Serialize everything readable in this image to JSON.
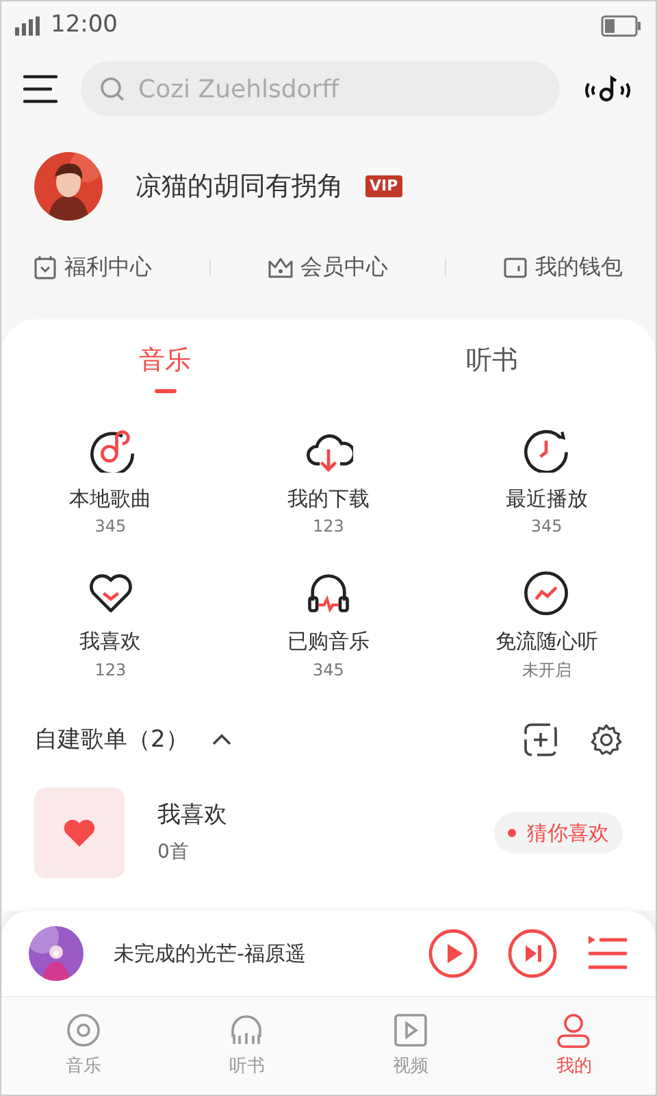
{
  "status_bar": {
    "time": "12:00"
  },
  "search": {
    "placeholder": "Cozi Zuehlsdorff"
  },
  "profile": {
    "name": "凉猫的胡同有拐角",
    "badge": "VIP"
  },
  "quick_links": [
    {
      "label": "福利中心"
    },
    {
      "label": "会员中心"
    },
    {
      "label": "我的钱包"
    }
  ],
  "tabs": [
    {
      "label": "音乐",
      "selected": true
    },
    {
      "label": "听书",
      "selected": false
    }
  ],
  "grid": [
    {
      "label": "本地歌曲",
      "count": "345"
    },
    {
      "label": "我的下载",
      "count": "123"
    },
    {
      "label": "最近播放",
      "count": "345"
    },
    {
      "label": "我喜欢",
      "count": "123"
    },
    {
      "label": "已购音乐",
      "count": "345"
    },
    {
      "label": "免流随心听",
      "count": "未开启"
    }
  ],
  "playlists_section": {
    "title": "自建歌单（2）",
    "expanded": true
  },
  "playlists": [
    {
      "title": "我喜欢",
      "count": "0首",
      "tag": "猜你喜欢"
    }
  ],
  "player": {
    "song": "未完成的光芒-福原遥"
  },
  "bottom_nav": [
    {
      "label": "音乐",
      "selected": false
    },
    {
      "label": "听书",
      "selected": false
    },
    {
      "label": "视频",
      "selected": false
    },
    {
      "label": "我的",
      "selected": true
    }
  ]
}
